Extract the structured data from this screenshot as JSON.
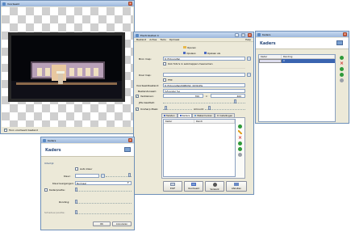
{
  "colors": {
    "accent": "#2a4a7a",
    "titlebar": "#9cb8dc",
    "green": "#2e9a3a",
    "red": "#d03030",
    "gray": "#9aa0a8"
  },
  "preview": {
    "title": "Voorbeeld",
    "footer_checkbox": "Toon voorbeeld bestand"
  },
  "main": {
    "title": "Electrobatiek 4",
    "menu": [
      "Bestand",
      "Acties",
      "Tools",
      "Opmaak",
      "Help"
    ],
    "toolbar": {
      "open": "Openen",
      "save": "Opslaan",
      "save_as": "Opslaan als"
    },
    "bron_map_label": "Bron map:",
    "bron_map_value": "D:\\Fotografie\\",
    "ook_fotos_checkbox": "Ook foto's in submappen meenemen",
    "doel_map_label": "Doel map:",
    "ftp_label": "FTP:",
    "voorbeeld_label": "Voorbeeldbestand:",
    "voorbeeld_value": "D:\\Fotografie\\2008\\DSC_0039.JPG",
    "bestandsnaam_label": "Bestandsnaam:",
    "bestandsnaam_value": "%Foonder %o",
    "verkleinen_label": "Verkleinen:",
    "width_value": "700",
    "height_value": "400",
    "x_label": "x",
    "jpg_label": "JPG kwaliteit:",
    "unsharp_label": "Unsharp Mask:",
    "amount_label": "Amount:",
    "tabs": [
      "Teksten",
      "Kaders",
      "Watermerken",
      "Instellingen"
    ],
    "table_headers": [
      "Kader",
      "Rondi"
    ],
    "footer_buttons": [
      "EXIF",
      "Voorbeeld",
      "Verwerk",
      "Afsluiten"
    ]
  },
  "kaders_right": {
    "title": "Kaders",
    "heading": "Kaders",
    "headers": [
      "Kader",
      "Ronding"
    ],
    "row_value": "0"
  },
  "kaders_dialog": {
    "title": "Kaders",
    "heading": "Kaders",
    "section": "Uiterlijk",
    "auto_kleur": "Auto kleur",
    "kleur_label": "Kleur:",
    "hoeken_label": "Kleurovergangen:",
    "hoeken_value": "Normaal",
    "kaderpositie_label": "Kaderpositie:",
    "ronding_label": "Ronding:",
    "schaduw_label": "Schaduw positie:",
    "ok": "OK",
    "cancel": "Annuleren"
  }
}
